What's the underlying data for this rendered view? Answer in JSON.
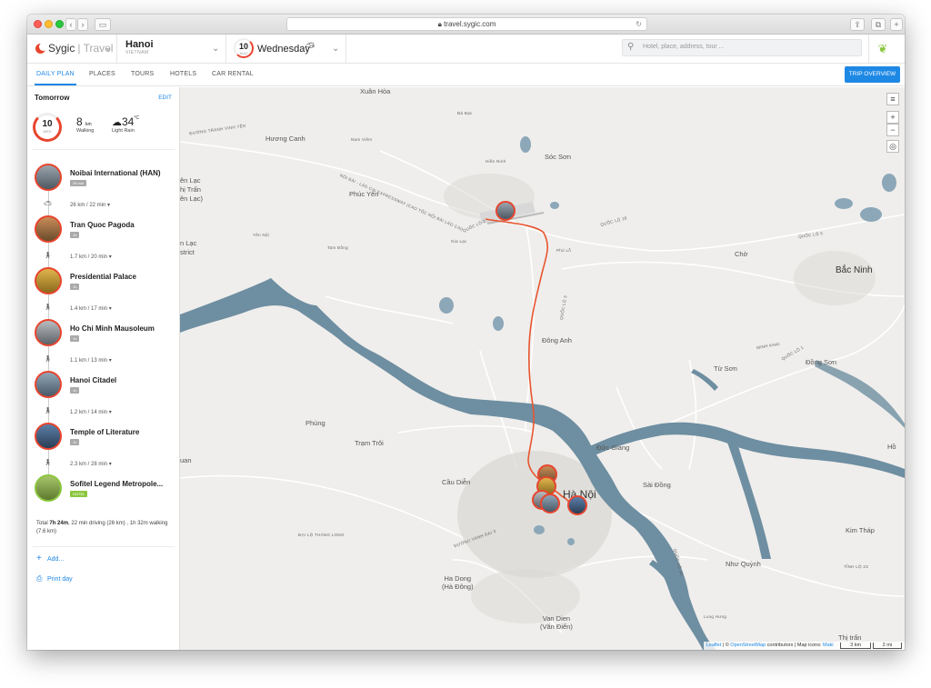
{
  "browser": {
    "url": "travel.sygic.com"
  },
  "header": {
    "logo_brand": "Sygic",
    "logo_sub": "Travel",
    "city": "Hanoi",
    "country": "VIETNAM",
    "date_day": "10",
    "date_month": "AUG",
    "day_name": "Wednesday",
    "search_placeholder": "Hotel, place, address, tour ..."
  },
  "tabs": [
    "DAILY PLAN",
    "PLACES",
    "TOURS",
    "HOTELS",
    "CAR RENTAL"
  ],
  "trip_overview_label": "TRIP OVERVIEW",
  "sidebar": {
    "title": "Tomorrow",
    "edit_label": "EDIT",
    "date_day": "10",
    "date_weekday": "WED",
    "distance_value": "8",
    "distance_unit": "km",
    "distance_label": "Walking",
    "temp_value": "34",
    "temp_unit": "°C",
    "weather_label": "Light Rain",
    "stops": [
      {
        "name": "Noibai International (HAN)",
        "tag": "26 min"
      },
      {
        "name": "Tran Quoc Pagoda",
        "tag": "1h"
      },
      {
        "name": "Presidential Palace",
        "tag": "1h"
      },
      {
        "name": "Ho Chi Minh Mausoleum",
        "tag": "1h"
      },
      {
        "name": "Hanoi Citadel",
        "tag": "1h"
      },
      {
        "name": "Temple of Literature",
        "tag": "1h"
      },
      {
        "name": "Sofitel Legend Metropole...",
        "tag": "HOTEL"
      }
    ],
    "legs": [
      {
        "text": "26 km  /  22 min"
      },
      {
        "text": "1.7 km  /  20 min"
      },
      {
        "text": "1.4 km  /  17 min"
      },
      {
        "text": "1.1 km  /  13 min"
      },
      {
        "text": "1.2 km  /  14 min"
      },
      {
        "text": "2.3 km  /  28 min"
      }
    ],
    "total_prefix": "Total",
    "total_time": "7h 24m",
    "total_rest": ", 22 min driving (26 km) , 1h 32m walking (7.6 km)",
    "add_label": "Add...",
    "print_label": "Print day"
  },
  "map": {
    "labels": {
      "xuan_hoa": "Xuân Hòa",
      "huong_canh": "Hương Canh",
      "soc_son": "Sóc Sơn",
      "phuc_yen": "Phúc Yên",
      "dong_anh": "Đông Anh",
      "bac_ninh": "Bắc Ninh",
      "tu_son": "Từ Sơn",
      "dong_son": "Đồng Sơn",
      "phung": "Phùng",
      "tram_troi": "Trạm Trôi",
      "duc_giang": "Đức Giang",
      "cau_dien": "Cầu Diễn",
      "sai_dong": "Sài Đồng",
      "hanoi": "Hà Nội",
      "ha_dong": "Ha Dong\n(Hà Đông)",
      "van_dien": "Van Dien\n(Văn Điển)",
      "nhu_quynh": "Như Quỳnh",
      "kim_thap": "Kim Tháp",
      "thi_tran": "Thị trấn",
      "cho": "Chờ",
      "ho": "Hồ",
      "lien_lac": "ên Lạc\nhị Trấn\nên Lạc)",
      "lac_district": "n Lạc\nstrict",
      "nam_viem": "Nam Viêm",
      "hien_ninh": "Hiền Ninh",
      "da_bac": "Đá Bạc",
      "gia_lac": "Gia Lạc",
      "phu_lo": "Phú Lỗ",
      "tam_dong": "Tam Đồng",
      "yen_noi": "Yên Nội",
      "long_hung": "Long Hưng",
      "uan": "uan",
      "r_duong_tranh": "ĐƯỜNG TRANH VINH YÊN",
      "r_noi_bai": "NỘI BÀI - LÀO CAI EXPRESSWAY (CAO TỐC NỘI BÀI LÀO CAI)",
      "r_ql2": "QUỐC LỘ 2",
      "r_ql3": "QUỐC LỘ 3",
      "r_ql18": "QUỐC LỘ 18",
      "r_ql1": "QUỐC LỘ 1",
      "r_dl_thang_long": "ĐẠI LỘ THĂNG LONG",
      "r_ql5": "QUỐC LỘ 5",
      "r_ql38": "QUỐC LỘ 38",
      "r_vanh_dai": "ĐƯỜNG VÀNH ĐAI 3",
      "r_tinh_lo": "TỈNH LỘ 23",
      "r_minh_khai": "MINH KHAI"
    },
    "attribution_leaflet": "Leaflet",
    "attribution_osm": "OpenStreetMap",
    "attribution_rest": "contributors | Map icons: ",
    "attribution_maki": "Maki",
    "scale_km": "3 km",
    "scale_mi": "2 mi"
  },
  "colors": {
    "accent": "#1e88e5",
    "route": "#e8552e",
    "river": "#6e8ea1",
    "map_bg": "#efeeec"
  }
}
